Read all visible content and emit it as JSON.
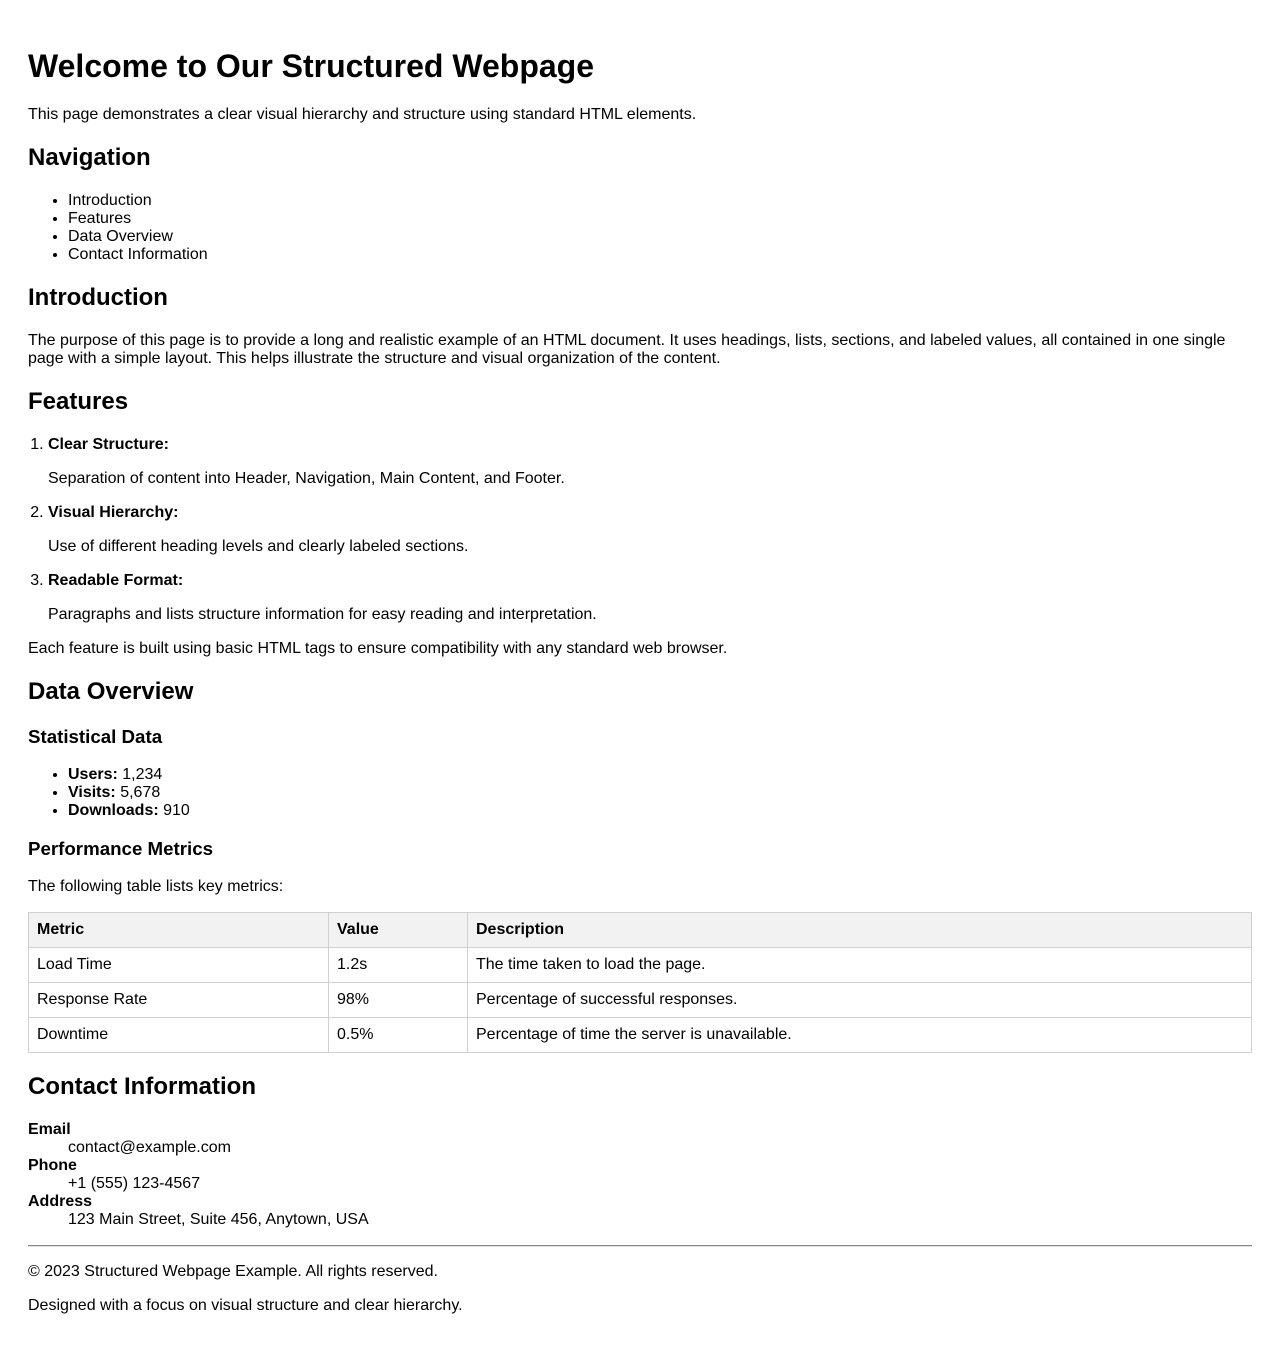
{
  "header": {
    "title": "Welcome to Our Structured Webpage",
    "intro": "This page demonstrates a clear visual hierarchy and structure using standard HTML elements."
  },
  "navigation": {
    "heading": "Navigation",
    "items": [
      "Introduction",
      "Features",
      "Data Overview",
      "Contact Information"
    ]
  },
  "introduction": {
    "heading": "Introduction",
    "text": "The purpose of this page is to provide a long and realistic example of an HTML document. It uses headings, lists, sections, and labeled values, all contained in one single page with a simple layout. This helps illustrate the structure and visual organization of the content."
  },
  "features": {
    "heading": "Features",
    "items": [
      {
        "title": "Clear Structure:",
        "desc": "Separation of content into Header, Navigation, Main Content, and Footer."
      },
      {
        "title": "Visual Hierarchy:",
        "desc": "Use of different heading levels and clearly labeled sections."
      },
      {
        "title": "Readable Format:",
        "desc": "Paragraphs and lists structure information for easy reading and interpretation."
      }
    ],
    "note": "Each feature is built using basic HTML tags to ensure compatibility with any standard web browser."
  },
  "data_overview": {
    "heading": "Data Overview",
    "stats_heading": "Statistical Data",
    "stats": [
      {
        "label": "Users:",
        "value": "1,234"
      },
      {
        "label": "Visits:",
        "value": "5,678"
      },
      {
        "label": "Downloads:",
        "value": "910"
      }
    ],
    "metrics_heading": "Performance Metrics",
    "metrics_intro": "The following table lists key metrics:",
    "table": {
      "headers": [
        "Metric",
        "Value",
        "Description"
      ],
      "rows": [
        [
          "Load Time",
          "1.2s",
          "The time taken to load the page."
        ],
        [
          "Response Rate",
          "98%",
          "Percentage of successful responses."
        ],
        [
          "Downtime",
          "0.5%",
          "Percentage of time the server is unavailable."
        ]
      ]
    }
  },
  "contact": {
    "heading": "Contact Information",
    "items": [
      {
        "label": "Email",
        "value": "contact@example.com"
      },
      {
        "label": "Phone",
        "value": "+1 (555) 123-4567"
      },
      {
        "label": "Address",
        "value": "123 Main Street, Suite 456, Anytown, USA"
      }
    ]
  },
  "footer": {
    "copyright": "© 2023 Structured Webpage Example. All rights reserved.",
    "tagline": "Designed with a focus on visual structure and clear hierarchy."
  }
}
